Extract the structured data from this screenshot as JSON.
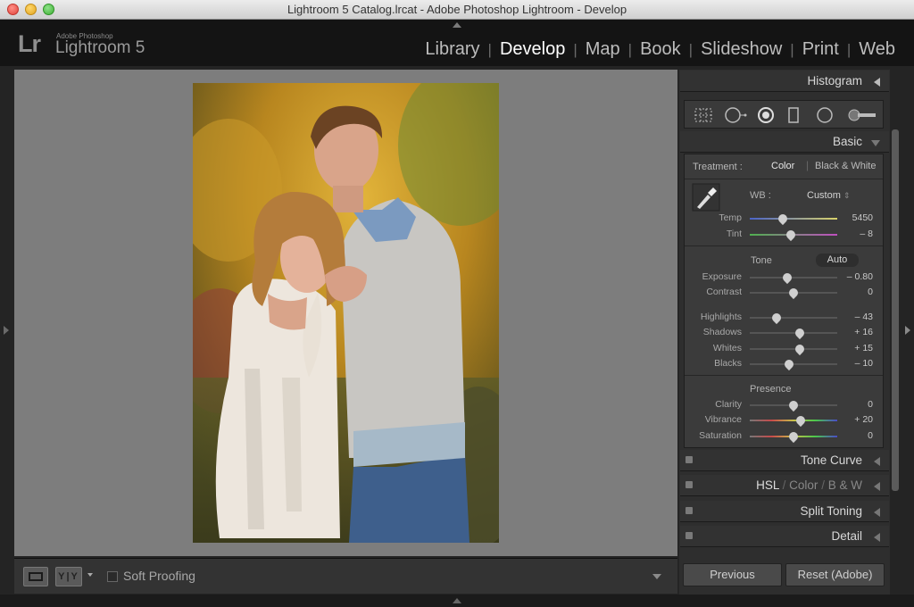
{
  "window": {
    "title": "Lightroom 5 Catalog.lrcat - Adobe Photoshop Lightroom - Develop"
  },
  "identity": {
    "logo": "Lr",
    "vendor": "Adobe Photoshop",
    "product": "Lightroom 5"
  },
  "modules": [
    "Library",
    "Develop",
    "Map",
    "Book",
    "Slideshow",
    "Print",
    "Web"
  ],
  "active_module": "Develop",
  "toolbar": {
    "soft_proofing_label": "Soft Proofing",
    "soft_proofing_checked": false,
    "before_after_label": "Y|Y"
  },
  "panels": {
    "histogram": "Histogram",
    "basic": "Basic",
    "tone_curve": "Tone Curve",
    "hsl": {
      "hsl": "HSL",
      "color": "Color",
      "bw": "B & W",
      "sep": "/"
    },
    "split_toning": "Split Toning",
    "detail": "Detail"
  },
  "basic": {
    "treatment_label": "Treatment :",
    "treatment_color": "Color",
    "treatment_bw": "Black & White",
    "wb_label": "WB :",
    "wb_value": "Custom",
    "tone_label": "Tone",
    "auto_label": "Auto",
    "presence_label": "Presence",
    "sliders": [
      {
        "key": "temp",
        "label": "Temp",
        "value": "5450",
        "pos": 0.38
      },
      {
        "key": "tint",
        "label": "Tint",
        "value": "– 8",
        "pos": 0.47
      },
      {
        "key": "exposure",
        "label": "Exposure",
        "value": "– 0.80",
        "pos": 0.43
      },
      {
        "key": "contrast",
        "label": "Contrast",
        "value": "0",
        "pos": 0.5
      },
      {
        "key": "highlights",
        "label": "Highlights",
        "value": "– 43",
        "pos": 0.31
      },
      {
        "key": "shadows",
        "label": "Shadows",
        "value": "+ 16",
        "pos": 0.57
      },
      {
        "key": "whites",
        "label": "Whites",
        "value": "+ 15",
        "pos": 0.57
      },
      {
        "key": "blacks",
        "label": "Blacks",
        "value": "– 10",
        "pos": 0.45
      },
      {
        "key": "clarity",
        "label": "Clarity",
        "value": "0",
        "pos": 0.5
      },
      {
        "key": "vibrance",
        "label": "Vibrance",
        "value": "+ 20",
        "pos": 0.58
      },
      {
        "key": "saturation",
        "label": "Saturation",
        "value": "0",
        "pos": 0.5
      }
    ]
  },
  "buttons": {
    "previous": "Previous",
    "reset": "Reset (Adobe)"
  },
  "icons": [
    "crop-overlay-icon",
    "spot-removal-icon",
    "red-eye-icon",
    "graduated-filter-icon",
    "radial-filter-icon",
    "adjustment-brush-icon",
    "white-balance-eyedropper-icon"
  ],
  "colors": {
    "canvas": "#7d7d7d",
    "panel": "#3b3b3b",
    "active_module": "#ffffff"
  }
}
